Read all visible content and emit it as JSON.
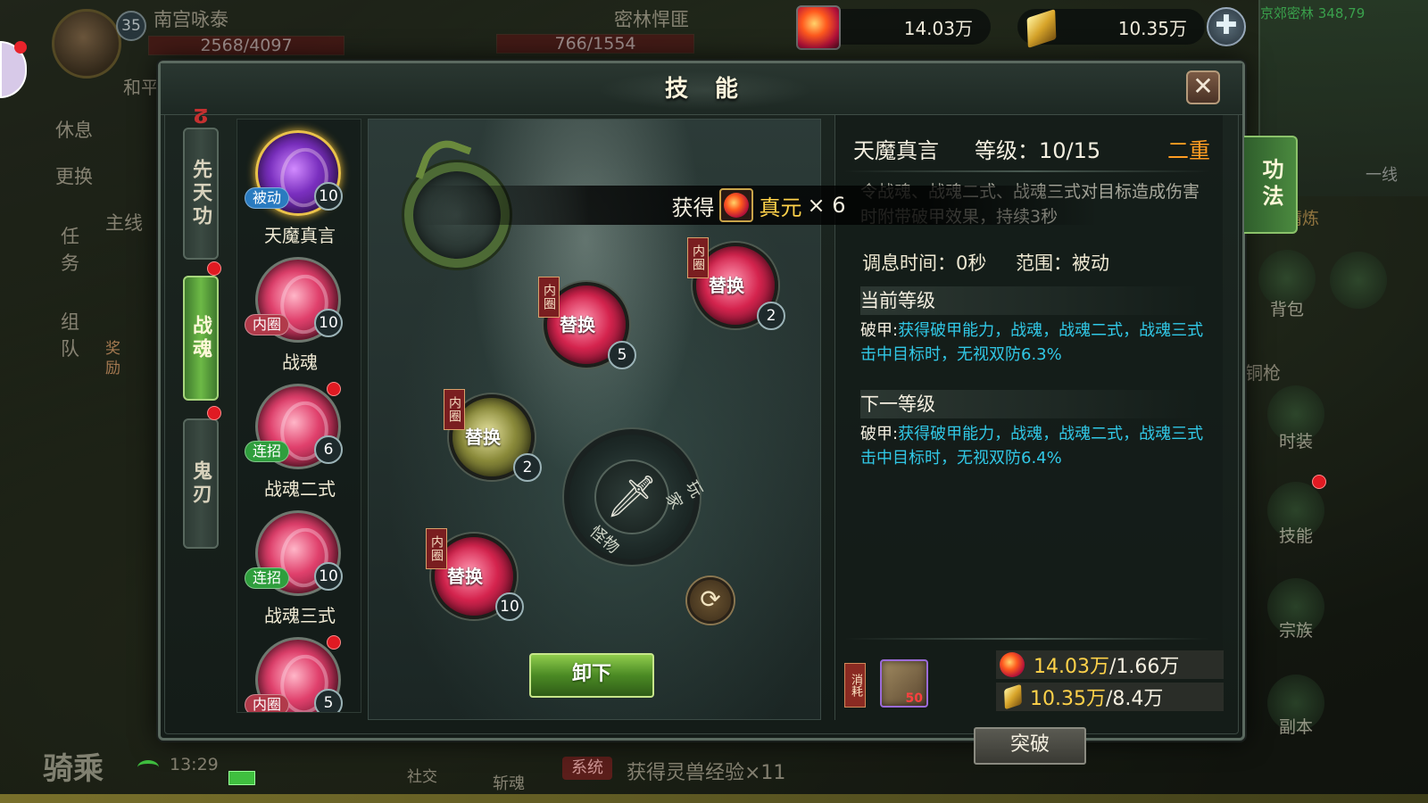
{
  "hud": {
    "player_level": "35",
    "player_name": "南宫咏泰",
    "player_hp": "2568/4097",
    "target_name": "密林悍匪",
    "target_hp": "766/1554",
    "peace_mode": "和平",
    "rest_label": "休息",
    "change_label": "更换",
    "quest_tab": "任务",
    "team_tab": "组队",
    "main_quest": "主线",
    "reward_label": "奖励",
    "resource_a": "14.03万",
    "resource_b": "10.35万",
    "map_name": "京郊密林 348,79",
    "line_label": "一线",
    "refine_label": "精炼",
    "bag_label": "背包",
    "copper_label": "铜枪",
    "fashion_label": "时装",
    "skill_label": "技能",
    "sect_label": "宗族",
    "dungeon_label": "副本",
    "ride_label": "骑乘",
    "time": "13:29",
    "social_label": "社交",
    "slay_label": "斩魂",
    "system_tag": "系统",
    "system_msg": "获得灵兽经验×11"
  },
  "dialog": {
    "title": "技能",
    "close": "✕",
    "vtabs": [
      {
        "label": "先天功",
        "active": false
      },
      {
        "label": "战魂",
        "active": true
      },
      {
        "label": "鬼刃",
        "active": false
      }
    ],
    "skills": [
      {
        "name": "天魔真言",
        "badge": "被动",
        "badge_type": "passive",
        "level": "10",
        "color": "purple"
      },
      {
        "name": "战魂",
        "badge": "内圈",
        "badge_type": "inner",
        "level": "10",
        "color": "red"
      },
      {
        "name": "战魂二式",
        "badge": "连招",
        "badge_type": "combo",
        "level": "6",
        "color": "red"
      },
      {
        "name": "战魂三式",
        "badge": "连招",
        "badge_type": "combo",
        "level": "10",
        "color": "red"
      },
      {
        "name": "",
        "badge": "内圈",
        "badge_type": "inner",
        "level": "5",
        "color": "red"
      }
    ],
    "slots": [
      {
        "tag": "内圈",
        "label": "替换",
        "level": "2",
        "color": "red"
      },
      {
        "tag": "内圈",
        "label": "替换",
        "level": "5",
        "color": "red"
      },
      {
        "tag": "内圈",
        "label": "替换",
        "level": "2",
        "color": "olive"
      },
      {
        "tag": "内圈",
        "label": "替换",
        "level": "10",
        "color": "red"
      }
    ],
    "dial": {
      "player": "玩家",
      "monster": "怪物"
    },
    "unload_button": "卸下",
    "toast": {
      "prefix": "获得",
      "item": "真元",
      "count": "× 6"
    }
  },
  "info": {
    "name": "天魔真言",
    "level": "等级：10/15",
    "tier": "二重",
    "description": "令战魂、战魂二式、战魂三式对目标造成伤害时附带破甲效果，持续3秒",
    "cooldown": "调息时间：0秒",
    "range": "范围：被动",
    "current_title": "当前等级",
    "current_key": "破甲:",
    "current_desc": "获得破甲能力，战魂，战魂二式，战魂三式击中目标时，无视双防6.3%",
    "next_title": "下一等级",
    "next_key": "破甲:",
    "next_desc": "获得破甲能力，战魂，战魂二式，战魂三式击中目标时，无视双防6.4%",
    "cost_tag": "消耗",
    "cost_book_count": "50",
    "cost_red_have": "14.03万",
    "cost_red_need": "/1.66万",
    "cost_gold_have": "10.35万",
    "cost_gold_need": "/8.4万",
    "break_button": "突破",
    "side_tab": "功法"
  }
}
